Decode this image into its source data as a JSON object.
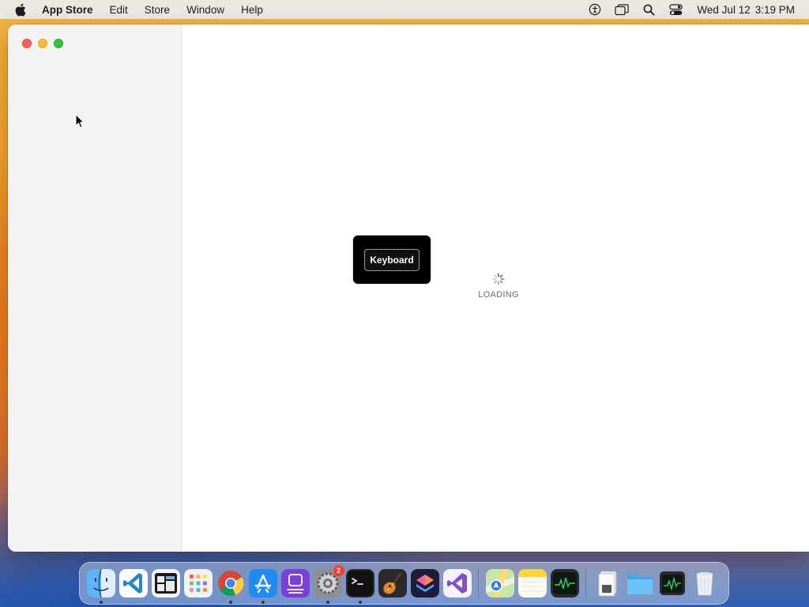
{
  "menubar": {
    "apple_icon": "apple-logo-icon",
    "app_name": "App Store",
    "menus": [
      "Edit",
      "Store",
      "Window",
      "Help"
    ],
    "status_icons": [
      "accessibility-icon",
      "screen-mirroring-icon",
      "spotlight-search-icon",
      "control-center-icon"
    ],
    "date": "Wed Jul 12",
    "time": "3:19 PM"
  },
  "window": {
    "traffic_lights": [
      "close",
      "minimize",
      "zoom"
    ],
    "keyboard_hud": {
      "label": "Keyboard"
    },
    "loading": {
      "label": "LOADING"
    }
  },
  "dock": {
    "apps": [
      {
        "name": "Finder",
        "icon": "finder-icon",
        "running": true
      },
      {
        "name": "Visual Studio Code",
        "icon": "vscode-icon",
        "running": false
      },
      {
        "name": "Window Manager",
        "icon": "window-manager-icon",
        "running": false
      },
      {
        "name": "Launchpad",
        "icon": "launchpad-icon",
        "running": false
      },
      {
        "name": "Google Chrome",
        "icon": "chrome-icon",
        "running": true
      },
      {
        "name": "App Store",
        "icon": "app-store-icon",
        "running": true
      },
      {
        "name": "Podcast Tool",
        "icon": "purple-app-icon",
        "running": false
      },
      {
        "name": "System Settings",
        "icon": "system-settings-icon",
        "running": true,
        "badge": "2"
      },
      {
        "name": "Terminal",
        "icon": "terminal-icon",
        "running": true
      },
      {
        "name": "GarageBand",
        "icon": "garageband-icon",
        "running": false
      },
      {
        "name": "Shortcuts",
        "icon": "shortcuts-icon",
        "running": false
      },
      {
        "name": "Visual Studio",
        "icon": "visual-studio-icon",
        "running": false
      },
      {
        "name": "Maps",
        "icon": "maps-icon",
        "running": false
      },
      {
        "name": "Notes",
        "icon": "notes-icon",
        "running": false
      },
      {
        "name": "Activity Monitor",
        "icon": "activity-monitor-icon",
        "running": false
      }
    ],
    "extras": [
      {
        "name": "Document",
        "icon": "document-stack-icon"
      },
      {
        "name": "Folder",
        "icon": "folder-icon"
      },
      {
        "name": "Activity Monitor Window",
        "icon": "activity-monitor-window-icon"
      },
      {
        "name": "Trash",
        "icon": "trash-icon"
      }
    ]
  }
}
